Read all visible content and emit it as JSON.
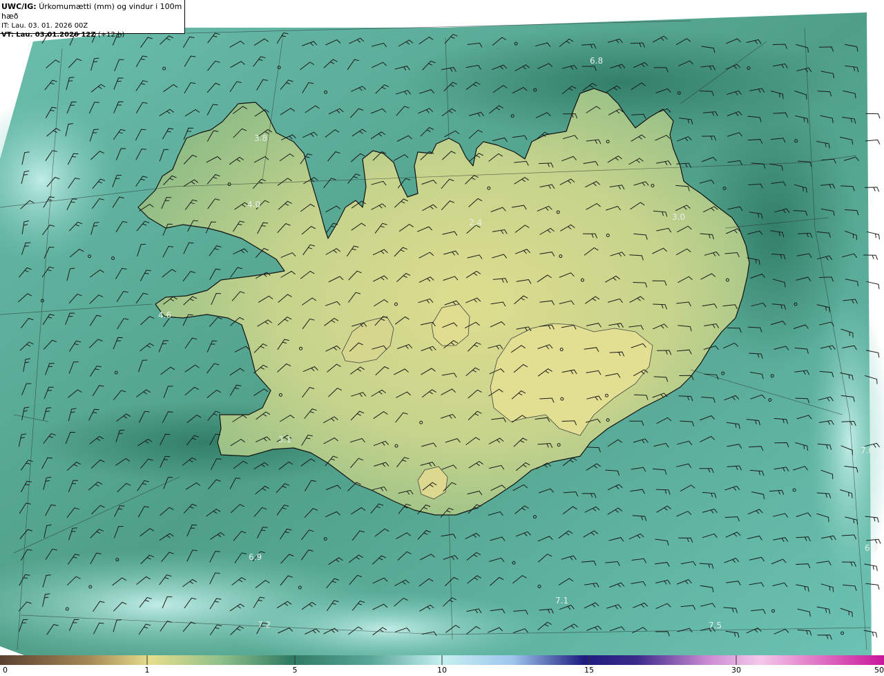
{
  "header": {
    "model": "UWC/IG:",
    "description": "Úrkomumætti (mm) og vindur i 100m hæð",
    "initial_time": "IT: Lau. 03. 01. 2026 00Z",
    "valid_prefix": "VT:",
    "valid_time": "Lau. 03.01.2026 12Z",
    "lead": "(+12 h)"
  },
  "values": [
    "6.8",
    "3.8",
    "4.0",
    "2.4",
    "3.0",
    "4.6",
    "3.1",
    "7.0",
    "6.9",
    "7.1",
    "7.2",
    "7.5",
    "6.9"
  ],
  "colorbar": {
    "ticks": [
      "0",
      "1",
      "5",
      "10",
      "15",
      "30",
      "50"
    ],
    "colors": [
      "#6b4e33",
      "#a88a54",
      "#e8e08a",
      "#2f7a63",
      "#8fd9d0",
      "#c9f2f7",
      "#2c2d9c",
      "#1b1b6b",
      "#b43ca6",
      "#f0b8e6",
      "#d63aa4"
    ]
  }
}
